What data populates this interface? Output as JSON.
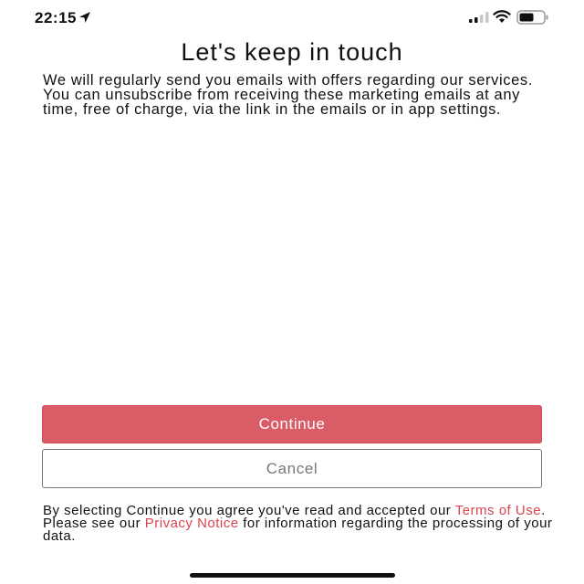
{
  "status_bar": {
    "time": "22:15",
    "icons": [
      "location-arrow-icon",
      "cellular-signal-icon",
      "wifi-icon",
      "battery-icon"
    ]
  },
  "page": {
    "title": "Let's keep in touch",
    "intro": "We will regularly send you emails with offers regarding our services. You can unsubscribe from receiving these marketing emails at any time, free of charge, via the link in the emails or in app settings."
  },
  "actions": {
    "continue_label": "Continue",
    "cancel_label": "Cancel"
  },
  "consent": {
    "part1": "By selecting Continue you agree you've read and accepted our ",
    "terms_link": "Terms of Use",
    "part2": ". Please see our ",
    "privacy_link": "Privacy Notice",
    "part3": " for information regarding the processing of your data."
  },
  "colors": {
    "accent": "#d95c66",
    "link": "#d9444f",
    "cancel_border": "#777777"
  }
}
